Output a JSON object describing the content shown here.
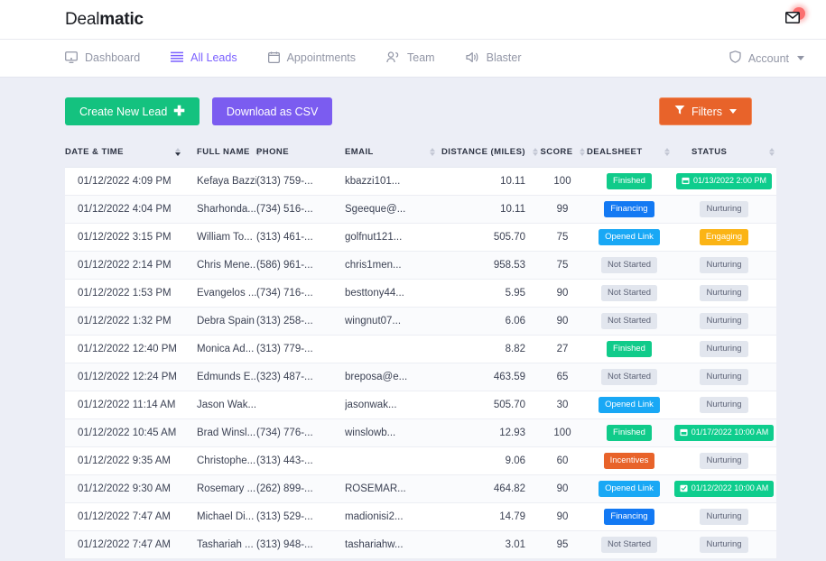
{
  "brand": {
    "light": "Deal",
    "bold": "matic"
  },
  "header": {
    "mail_icon": "envelope-icon",
    "notification_dot": true
  },
  "nav": {
    "items": [
      {
        "label": "Dashboard",
        "icon": "monitor-icon",
        "active": false
      },
      {
        "label": "All Leads",
        "icon": "list-icon",
        "active": true
      },
      {
        "label": "Appointments",
        "icon": "calendar-icon",
        "active": false
      },
      {
        "label": "Team",
        "icon": "people-icon",
        "active": false
      },
      {
        "label": "Blaster",
        "icon": "megaphone-icon",
        "active": false
      }
    ],
    "account": {
      "label": "Account",
      "icon": "shield-icon"
    }
  },
  "toolbar": {
    "create_lead": "Create New Lead",
    "create_lead_plus": "✚",
    "download_csv": "Download as CSV",
    "filters": "Filters",
    "filters_icon": "funnel-icon"
  },
  "colors": {
    "green": "#14c27f",
    "purple": "#7b5cf0",
    "orange": "#e8632a",
    "accent": "#7b61ff",
    "page_bg": "#eceef6"
  },
  "table": {
    "columns": [
      {
        "label": "DATE & TIME",
        "sortable": true,
        "sorted": true
      },
      {
        "label": "FULL NAME",
        "sortable": true,
        "sorted": false
      },
      {
        "label": "PHONE",
        "sortable": false,
        "sorted": false
      },
      {
        "label": "EMAIL",
        "sortable": true,
        "sorted": false
      },
      {
        "label": "DISTANCE (MILES)",
        "sortable": true,
        "sorted": false
      },
      {
        "label": "SCORE",
        "sortable": true,
        "sorted": false
      },
      {
        "label": "DEALSHEET",
        "sortable": true,
        "sorted": false
      },
      {
        "label": "STATUS",
        "sortable": true,
        "sorted": false
      }
    ],
    "rows": [
      {
        "date": "01/12/2022 4:09 PM",
        "name": "Kefaya Bazzi",
        "phone": "(313) 759-...",
        "email": "kbazzi101...",
        "distance": "10.11",
        "score": "100",
        "dealsheet": {
          "text": "Finished",
          "style": "b-green"
        },
        "status": {
          "text": "01/13/2022 2:00 PM",
          "style": "b-appt",
          "icon": "calendar-icon"
        }
      },
      {
        "date": "01/12/2022 4:04 PM",
        "name": "Sharhonda...",
        "phone": "(734) 516-...",
        "email": "Sgeeque@...",
        "distance": "10.11",
        "score": "99",
        "dealsheet": {
          "text": "Financing",
          "style": "b-blue"
        },
        "status": {
          "text": "Nurturing",
          "style": "b-gray"
        }
      },
      {
        "date": "01/12/2022 3:15 PM",
        "name": "William To...",
        "phone": "(313) 461-...",
        "email": "golfnut121...",
        "distance": "505.70",
        "score": "75",
        "dealsheet": {
          "text": "Opened Link",
          "style": "b-lightblue"
        },
        "status": {
          "text": "Engaging",
          "style": "b-amber"
        }
      },
      {
        "date": "01/12/2022 2:14 PM",
        "name": "Chris Mene...",
        "phone": "(586) 961-...",
        "email": "chris1men...",
        "distance": "958.53",
        "score": "75",
        "dealsheet": {
          "text": "Not Started",
          "style": "b-gray"
        },
        "status": {
          "text": "Nurturing",
          "style": "b-gray"
        }
      },
      {
        "date": "01/12/2022 1:53 PM",
        "name": "Evangelos ...",
        "phone": "(734) 716-...",
        "email": "besttony44...",
        "distance": "5.95",
        "score": "90",
        "dealsheet": {
          "text": "Not Started",
          "style": "b-gray"
        },
        "status": {
          "text": "Nurturing",
          "style": "b-gray"
        }
      },
      {
        "date": "01/12/2022 1:32 PM",
        "name": "Debra Spain",
        "phone": "(313) 258-...",
        "email": "wingnut07...",
        "distance": "6.06",
        "score": "90",
        "dealsheet": {
          "text": "Not Started",
          "style": "b-gray"
        },
        "status": {
          "text": "Nurturing",
          "style": "b-gray"
        }
      },
      {
        "date": "01/12/2022 12:40 PM",
        "name": "Monica Ad...",
        "phone": "(313) 779-...",
        "email": "",
        "distance": "8.82",
        "score": "27",
        "dealsheet": {
          "text": "Finished",
          "style": "b-green"
        },
        "status": {
          "text": "Nurturing",
          "style": "b-gray"
        }
      },
      {
        "date": "01/12/2022 12:24 PM",
        "name": "Edmunds E...",
        "phone": "(323) 487-...",
        "email": "breposa@e...",
        "distance": "463.59",
        "score": "65",
        "dealsheet": {
          "text": "Not Started",
          "style": "b-gray"
        },
        "status": {
          "text": "Nurturing",
          "style": "b-gray"
        }
      },
      {
        "date": "01/12/2022 11:14 AM",
        "name": "Jason Wak...",
        "phone": "",
        "email": "jasonwak...",
        "distance": "505.70",
        "score": "30",
        "dealsheet": {
          "text": "Opened Link",
          "style": "b-lightblue"
        },
        "status": {
          "text": "Nurturing",
          "style": "b-gray"
        }
      },
      {
        "date": "01/12/2022 10:45 AM",
        "name": "Brad Winsl...",
        "phone": "(734) 776-...",
        "email": "winslowb...",
        "distance": "12.93",
        "score": "100",
        "dealsheet": {
          "text": "Finished",
          "style": "b-green"
        },
        "status": {
          "text": "01/17/2022 10:00 AM",
          "style": "b-appt",
          "icon": "calendar-icon"
        }
      },
      {
        "date": "01/12/2022 9:35 AM",
        "name": "Christophe...",
        "phone": "(313) 443-...",
        "email": "",
        "distance": "9.06",
        "score": "60",
        "dealsheet": {
          "text": "Incentives",
          "style": "b-orange"
        },
        "status": {
          "text": "Nurturing",
          "style": "b-gray"
        }
      },
      {
        "date": "01/12/2022 9:30 AM",
        "name": "Rosemary ...",
        "phone": "(262) 899-...",
        "email": "ROSEMAR...",
        "distance": "464.82",
        "score": "90",
        "dealsheet": {
          "text": "Opened Link",
          "style": "b-lightblue"
        },
        "status": {
          "text": "01/12/2022 10:00 AM",
          "style": "b-appt",
          "icon": "calendar-check-icon"
        }
      },
      {
        "date": "01/12/2022 7:47 AM",
        "name": "Michael Di...",
        "phone": "(313) 529-...",
        "email": "madionisi2...",
        "distance": "14.79",
        "score": "90",
        "dealsheet": {
          "text": "Financing",
          "style": "b-blue"
        },
        "status": {
          "text": "Nurturing",
          "style": "b-gray"
        }
      },
      {
        "date": "01/12/2022 7:47 AM",
        "name": "Tashariah ...",
        "phone": "(313) 948-...",
        "email": "tashariahw...",
        "distance": "3.01",
        "score": "95",
        "dealsheet": {
          "text": "Not Started",
          "style": "b-gray"
        },
        "status": {
          "text": "Nurturing",
          "style": "b-gray"
        }
      }
    ]
  }
}
